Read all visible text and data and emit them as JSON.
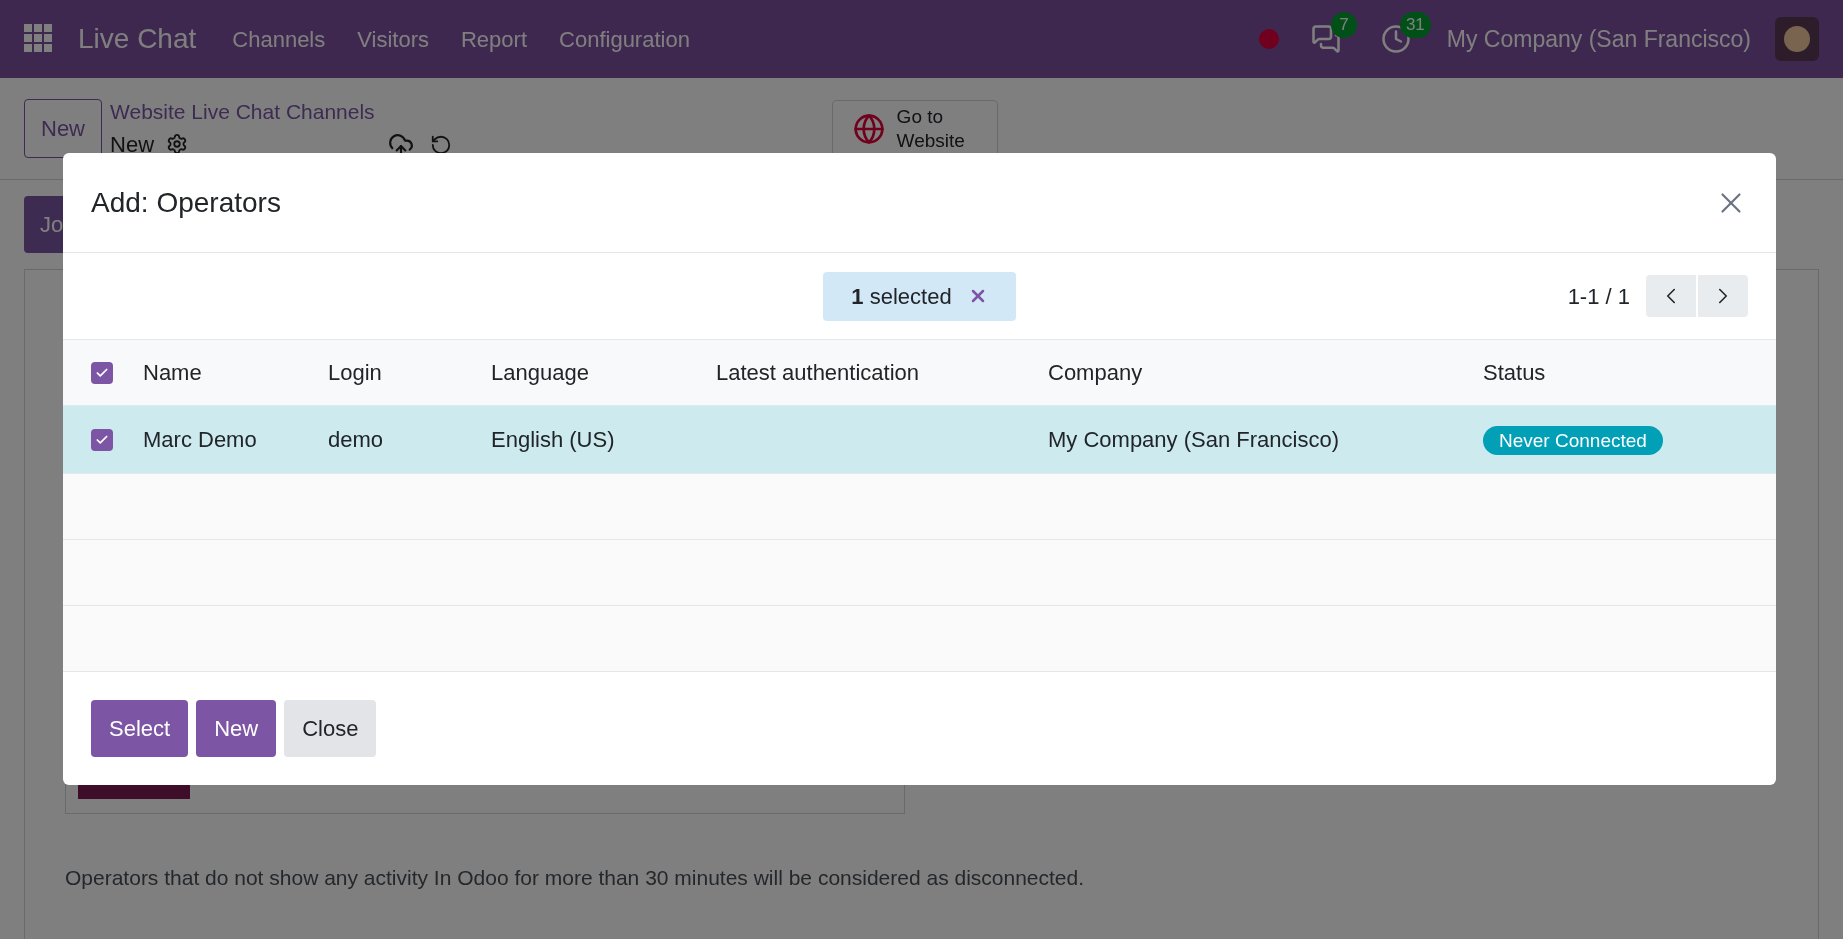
{
  "navbar": {
    "app_name": "Live Chat",
    "menu": [
      {
        "label": "Channels"
      },
      {
        "label": "Visitors"
      },
      {
        "label": "Report"
      },
      {
        "label": "Configuration"
      }
    ],
    "messages_count": "7",
    "activities_count": "31",
    "company": "My Company (San Francisco)"
  },
  "control_panel": {
    "new_button": "New",
    "breadcrumb": "Website Live Chat Channels",
    "record_title": "New",
    "website_button": "Go to Website"
  },
  "form": {
    "action_button": "Jo",
    "note": "Operators that do not show any activity In Odoo for more than 30 minutes will be considered as disconnected."
  },
  "dialog": {
    "title": "Add: Operators",
    "selection": {
      "count": "1",
      "label": "selected"
    },
    "pager": "1-1 / 1",
    "table": {
      "all_checked": true,
      "columns": [
        "Name",
        "Login",
        "Language",
        "Latest authentication",
        "Company",
        "Status"
      ],
      "rows": [
        {
          "selected": true,
          "checked": true,
          "name": "Marc Demo",
          "login": "demo",
          "language": "English (US)",
          "latest_authentication": "",
          "company": "My Company (San Francisco)",
          "status": "Never Connected"
        }
      ]
    },
    "buttons": [
      {
        "label": "Select",
        "kind": "primary"
      },
      {
        "label": "New",
        "kind": "primary"
      },
      {
        "label": "Close",
        "kind": "secondary"
      }
    ]
  }
}
